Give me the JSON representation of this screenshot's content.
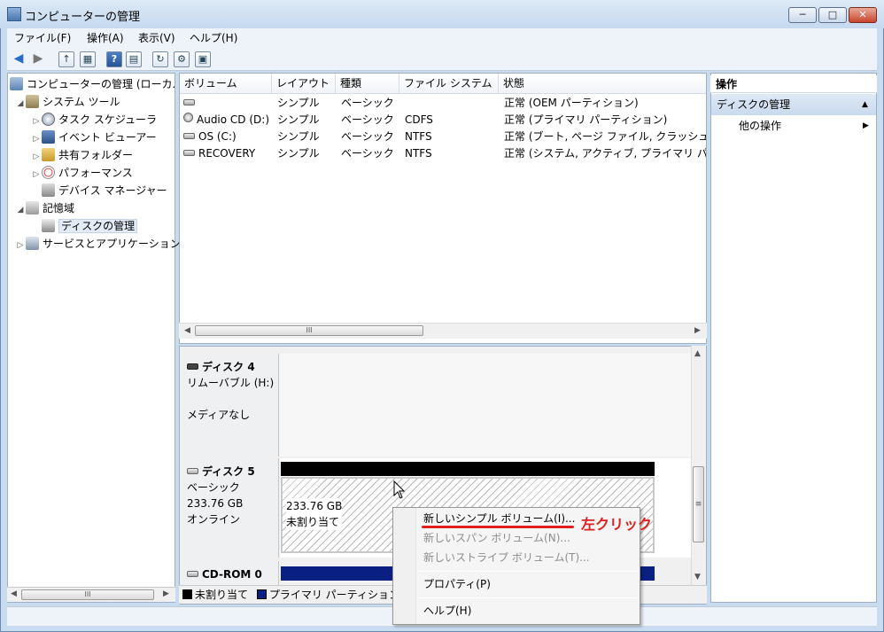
{
  "window": {
    "title": "コンピューターの管理",
    "min": "─",
    "max": "□",
    "close": "✕"
  },
  "menus": [
    "ファイル(F)",
    "操作(A)",
    "表示(V)",
    "ヘルプ(H)"
  ],
  "toolbar": {
    "back": "◀",
    "forward": "▶",
    "up": "↑",
    "tree": "▦",
    "help": "?",
    "view": "▤",
    "refresh": "↻",
    "props": "⚙",
    "export": "▣"
  },
  "tree": {
    "root": "コンピューターの管理 (ローカル)",
    "system_tools": "システム ツール",
    "task_scheduler": "タスク スケジューラ",
    "event_viewer": "イベント ビューアー",
    "shared_folders": "共有フォルダー",
    "performance": "パフォーマンス",
    "device_manager": "デバイス マネージャー",
    "storage": "記憶域",
    "disk_management": "ディスクの管理",
    "services": "サービスとアプリケーション",
    "scroll_grip": "III"
  },
  "list": {
    "headers": [
      "ボリューム",
      "レイアウト",
      "種類",
      "ファイル システム",
      "状態"
    ],
    "rows": [
      {
        "volume": "",
        "layout": "シンプル",
        "type": "ベーシック",
        "fs": "",
        "status": "正常 (OEM パーティション)"
      },
      {
        "volume": "Audio CD (D:)",
        "layout": "シンプル",
        "type": "ベーシック",
        "fs": "CDFS",
        "status": "正常 (プライマリ パーティション)"
      },
      {
        "volume": "OS (C:)",
        "layout": "シンプル",
        "type": "ベーシック",
        "fs": "NTFS",
        "status": "正常 (ブート, ページ ファイル, クラッシュ ダンプ"
      },
      {
        "volume": "RECOVERY",
        "layout": "シンプル",
        "type": "ベーシック",
        "fs": "NTFS",
        "status": "正常 (システム, アクティブ, プライマリ パーティション)"
      }
    ],
    "scroll_grip": "III"
  },
  "disks": {
    "disk4": {
      "name": "ディスク 4",
      "type": "リムーバブル (H:)",
      "media": "メディアなし"
    },
    "disk5": {
      "name": "ディスク 5",
      "type": "ベーシック",
      "size": "233.76 GB",
      "state": "オンライン",
      "partition_size": "233.76 GB",
      "partition_state": "未割り当て"
    },
    "cdrom": {
      "name": "CD-ROM 0"
    }
  },
  "legend": {
    "unallocated": "未割り当て",
    "primary": "プライマリ パーティション"
  },
  "actions": {
    "header": "操作",
    "sub": "ディスクの管理",
    "more": "他の操作"
  },
  "context_menu": {
    "new_simple": "新しいシンプル ボリューム(I)...",
    "new_spanned": "新しいスパン ボリューム(N)...",
    "new_striped": "新しいストライプ ボリューム(T)...",
    "properties": "プロパティ(P)",
    "help": "ヘルプ(H)"
  },
  "annotation": "左クリック",
  "colors": {
    "accent": "#e0201e",
    "primary_partition": "#0a1f82",
    "unallocated": "#000000",
    "selection": "#c9daee"
  }
}
